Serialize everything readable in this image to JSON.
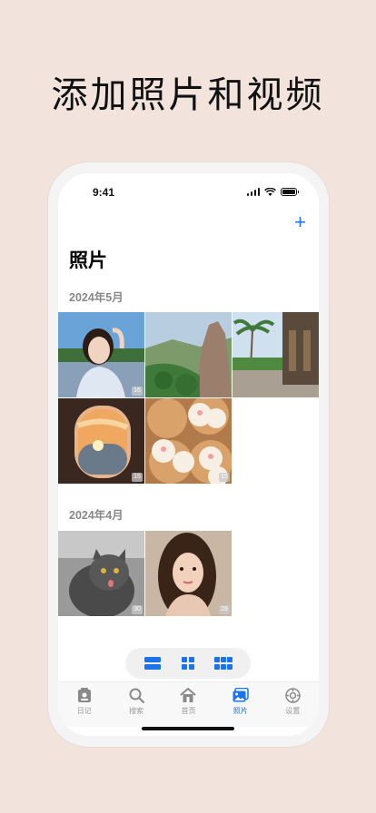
{
  "headline": "添加照片和视频",
  "status_bar": {
    "time": "9:41"
  },
  "header": {
    "add_label": "+",
    "title": "照片"
  },
  "sections": [
    {
      "title": "2024年5月",
      "photos": [
        {
          "subject": "portrait-woman-outdoors",
          "badge": "16"
        },
        {
          "subject": "rocky-mountain-landscape",
          "badge": ""
        },
        {
          "subject": "palm-trees-wooden-house",
          "badge": ""
        },
        {
          "subject": "airplane-window-sunset",
          "badge": "15"
        },
        {
          "subject": "steamed-buns-dim-sum",
          "badge": "15"
        }
      ]
    },
    {
      "title": "2024年4月",
      "photos": [
        {
          "subject": "grey-cat-tongue-out",
          "badge": "30"
        },
        {
          "subject": "portrait-woman-wavy-hair",
          "badge": "28"
        }
      ]
    }
  ],
  "layout_switcher": {
    "options": [
      "list-layout",
      "grid-2x2",
      "grid-3x2"
    ],
    "selected": "list-layout"
  },
  "tab_bar": {
    "items": [
      {
        "label": "日记",
        "icon": "diary-icon",
        "active": false
      },
      {
        "label": "搜索",
        "icon": "search-icon",
        "active": false
      },
      {
        "label": "首页",
        "icon": "home-icon",
        "active": false
      },
      {
        "label": "照片",
        "icon": "photos-icon",
        "active": true
      },
      {
        "label": "设置",
        "icon": "settings-icon",
        "active": false
      }
    ]
  },
  "colors": {
    "accent": "#1a73e8",
    "background": "#f2e4dc"
  }
}
